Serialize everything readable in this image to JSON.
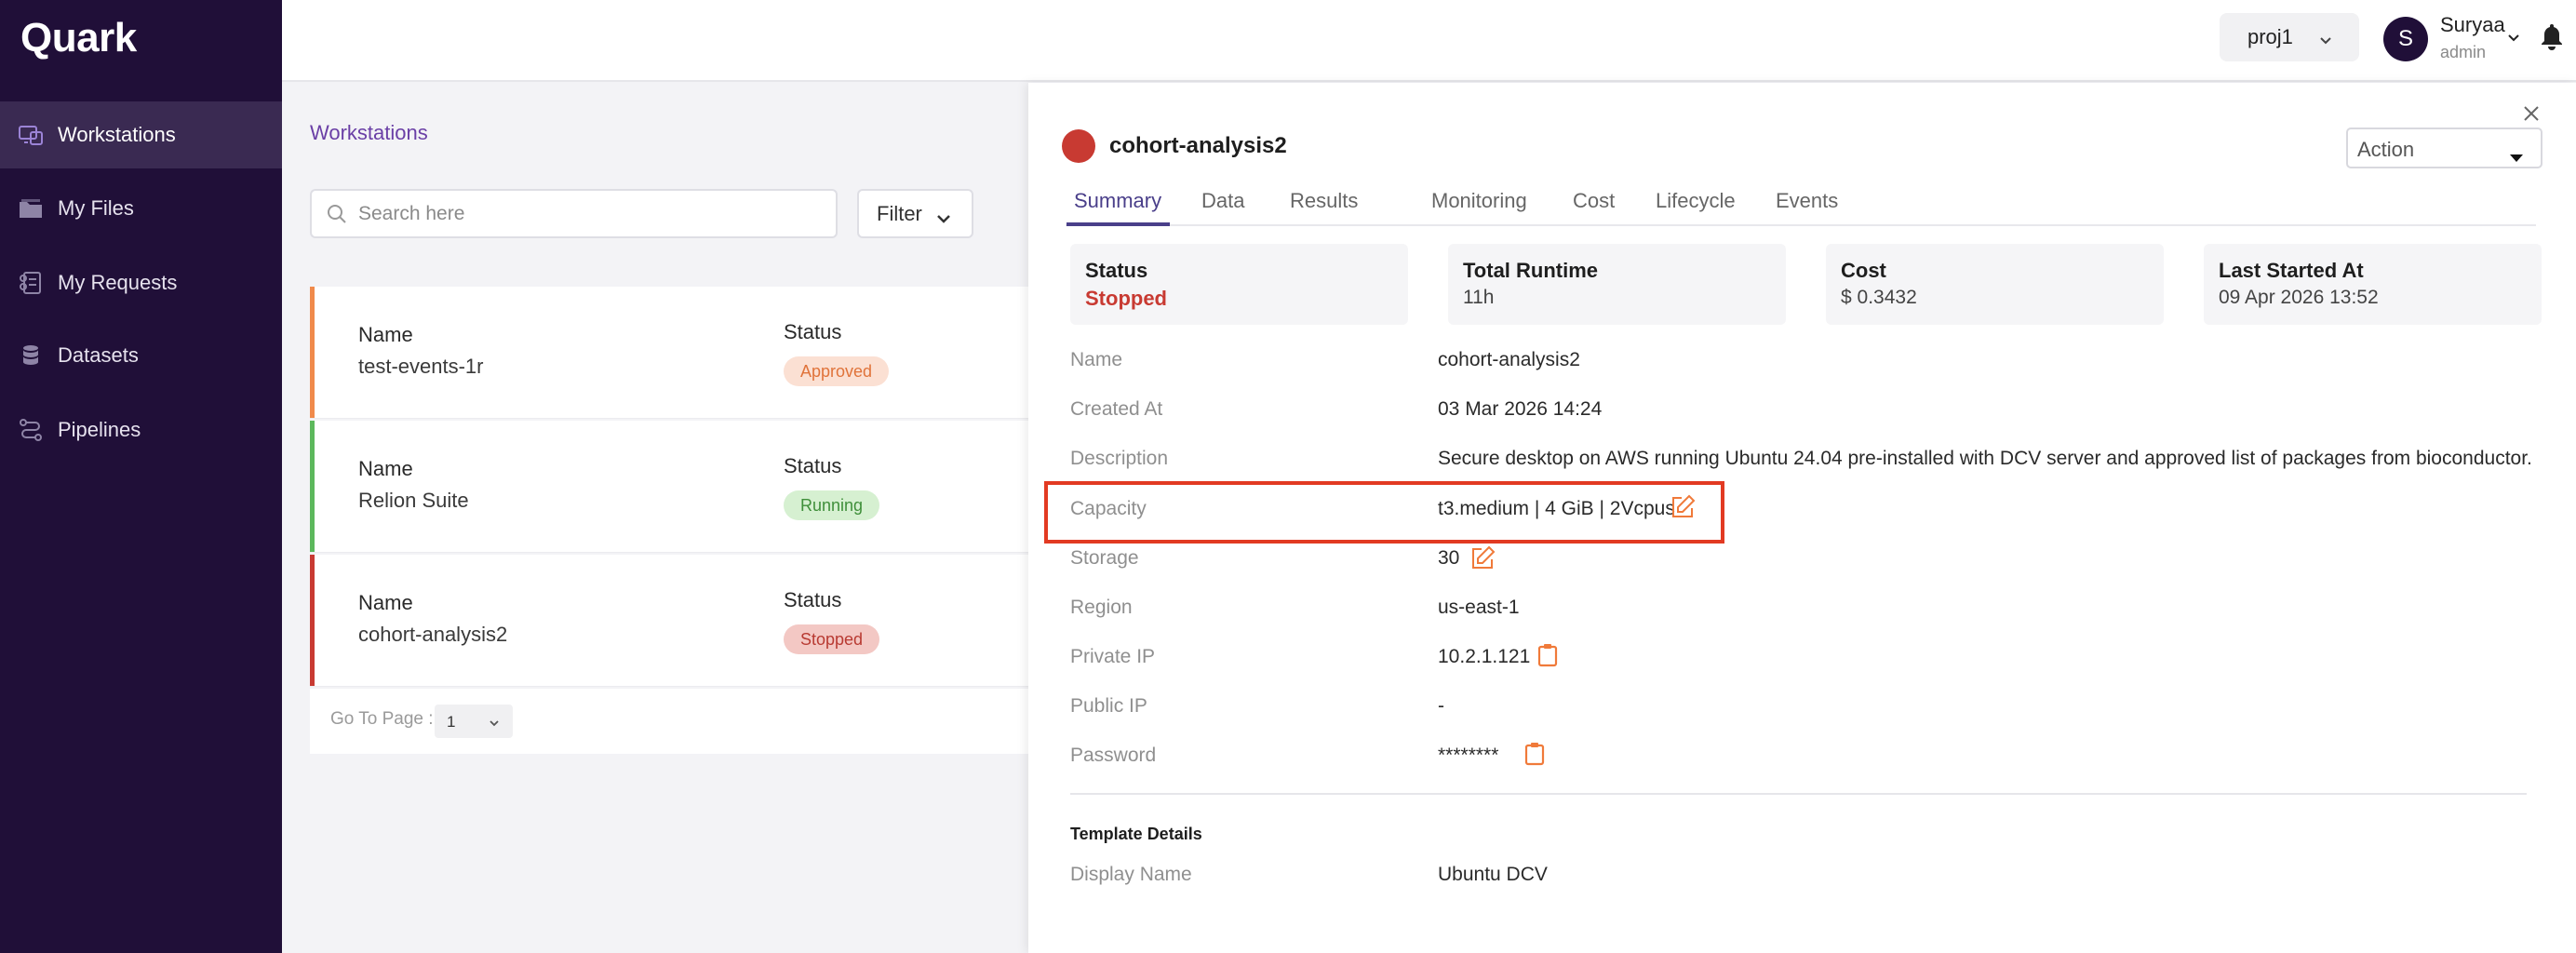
{
  "app": {
    "name": "Quark"
  },
  "sidebar": {
    "items": [
      {
        "label": "Workstations",
        "icon": "workstation-icon",
        "active": true
      },
      {
        "label": "My Files",
        "icon": "folder-icon",
        "active": false
      },
      {
        "label": "My Requests",
        "icon": "requests-icon",
        "active": false
      },
      {
        "label": "Datasets",
        "icon": "database-icon",
        "active": false
      },
      {
        "label": "Pipelines",
        "icon": "pipeline-icon",
        "active": false
      }
    ]
  },
  "header": {
    "project": "proj1",
    "user": {
      "initial": "S",
      "name": "Suryaa",
      "role": "admin"
    }
  },
  "workstations": {
    "title": "Workstations",
    "search_placeholder": "Search here",
    "filter_label": "Filter",
    "name_label": "Name",
    "status_label": "Status",
    "items": [
      {
        "name": "test-events-1r",
        "status": "Approved",
        "color": "#f08a4b"
      },
      {
        "name": "Relion Suite",
        "status": "Running",
        "color": "#5cb85c"
      },
      {
        "name": "cohort-analysis2",
        "status": "Stopped",
        "color": "#c83a32"
      }
    ],
    "pager": {
      "label": "Go To Page :",
      "page": "1"
    }
  },
  "detail": {
    "title": "cohort-analysis2",
    "action_label": "Action",
    "tabs": [
      "Summary",
      "Data",
      "Results",
      "Monitoring",
      "Cost",
      "Lifecycle",
      "Events"
    ],
    "active_tab": "Summary",
    "stats": [
      {
        "label": "Status",
        "value": "Stopped"
      },
      {
        "label": "Total Runtime",
        "value": "11h"
      },
      {
        "label": "Cost",
        "value": "$ 0.3432"
      },
      {
        "label": "Last Started At",
        "value": "09 Apr 2026 13:52"
      }
    ],
    "fields": [
      {
        "label": "Name",
        "value": "cohort-analysis2"
      },
      {
        "label": "Created At",
        "value": "03 Mar 2026 14:24"
      },
      {
        "label": "Description",
        "value": "Secure desktop on AWS running Ubuntu 24.04 pre-installed with DCV server and approved list of packages from bioconductor."
      },
      {
        "label": "Capacity",
        "value": "t3.medium | 4 GiB | 2Vcpus"
      },
      {
        "label": "Storage",
        "value": "30"
      },
      {
        "label": "Region",
        "value": "us-east-1"
      },
      {
        "label": "Private IP",
        "value": "10.2.1.121"
      },
      {
        "label": "Public IP",
        "value": "-"
      },
      {
        "label": "Password",
        "value": "********"
      }
    ],
    "template_section": "Template Details",
    "template_fields": [
      {
        "label": "Display Name",
        "value": "Ubuntu DCV"
      }
    ]
  },
  "colors": {
    "sidebar_bg": "#200f38",
    "accent": "#4a3f8a",
    "highlight": "#e23a22",
    "stopped": "#c83a32",
    "edit_icon": "#f07a3a"
  }
}
